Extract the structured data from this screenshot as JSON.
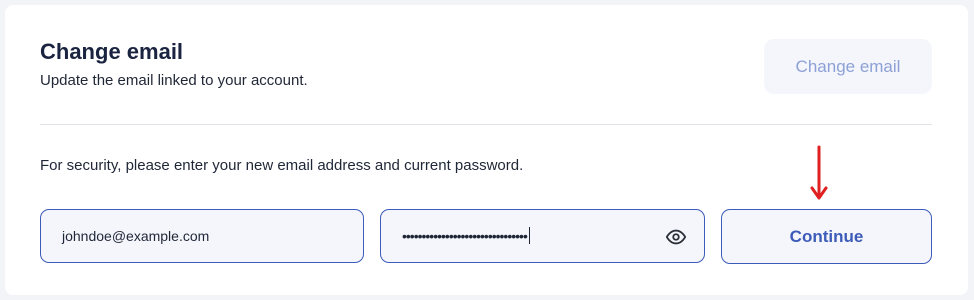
{
  "header": {
    "title": "Change email",
    "subtitle": "Update the email linked to your account.",
    "action_label": "Change email"
  },
  "form": {
    "instruction": "For security, please enter your new email address and current password.",
    "email_value": "johndoe@example.com",
    "password_value": "••••••••••••••••••••••••••••••••",
    "continue_label": "Continue"
  },
  "icons": {
    "visibility_toggle": "eye-icon",
    "annotation": "arrow-down-icon"
  },
  "colors": {
    "accent": "#3d5bb8",
    "annotation": "#e02020"
  }
}
